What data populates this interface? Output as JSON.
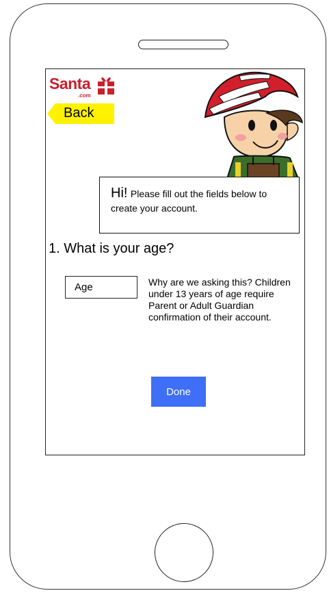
{
  "logo": {
    "text": "Santa",
    "sub": ".com"
  },
  "back_button": {
    "label": "Back"
  },
  "speech": {
    "greeting": "Hi!",
    "message": "Please fill out the fields below to create your account."
  },
  "question": {
    "text": "1. What is your age?"
  },
  "age_field": {
    "placeholder": "Age",
    "value": ""
  },
  "explanation": {
    "text": "Why are we asking this? Children under 13 years of age require Parent or Adult Guardian confirmation of their account."
  },
  "done_button": {
    "label": "Done"
  },
  "colors": {
    "brand": "#c9202c",
    "back_button": "#fff200",
    "done_button": "#3f6ff6"
  }
}
